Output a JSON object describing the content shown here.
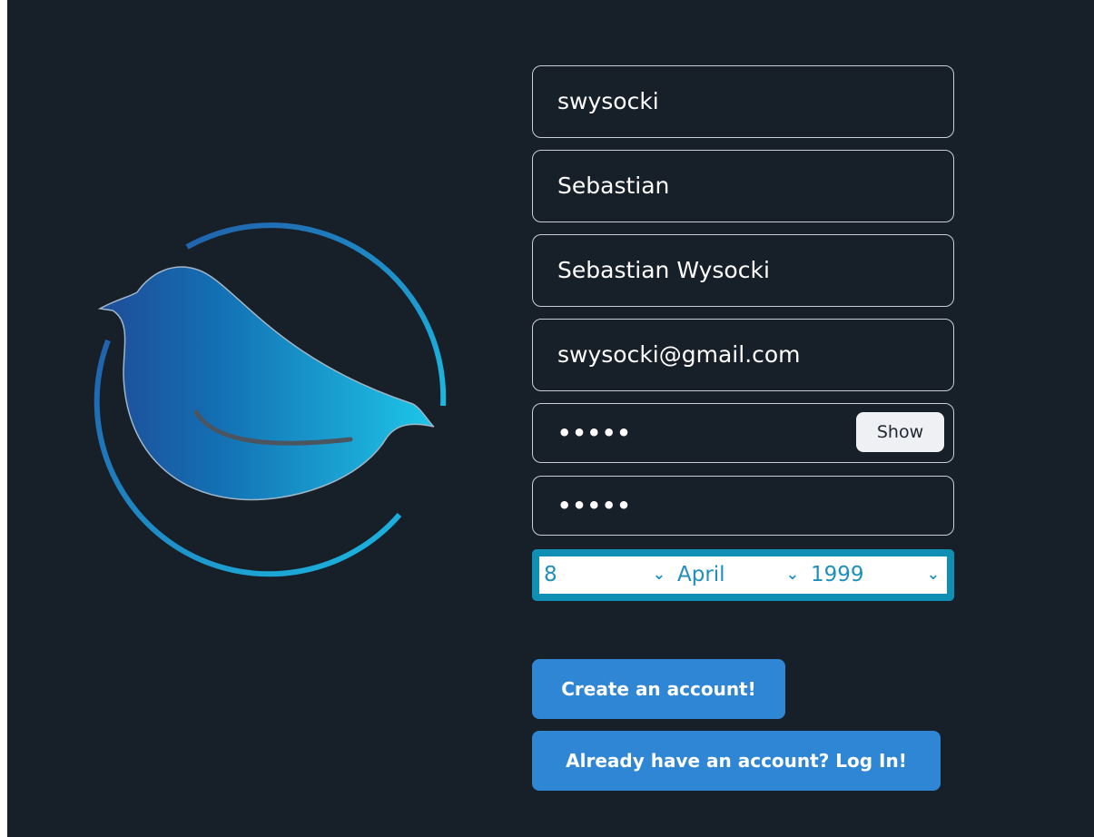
{
  "signup": {
    "username": "swysocki",
    "first_name": "Sebastian",
    "full_name": "Sebastian Wysocki",
    "email": "swysocki@gmail.com",
    "password_mask": "•••••",
    "confirm_password_mask": "•••••",
    "show_label": "Show",
    "birth_day": "8",
    "birth_month": "April",
    "birth_year": "1999",
    "create_label": "Create an account!",
    "login_label": "Already have an account? Log In!"
  },
  "icons": {
    "logo": "bird-logo-icon",
    "chevron": "chevron-down-icon"
  },
  "colors": {
    "background": "#171f29",
    "accent": "#2f86d4",
    "date_border": "#0f8fb3",
    "logo_dark": "#1f4c98",
    "logo_light": "#1ec6e8"
  }
}
